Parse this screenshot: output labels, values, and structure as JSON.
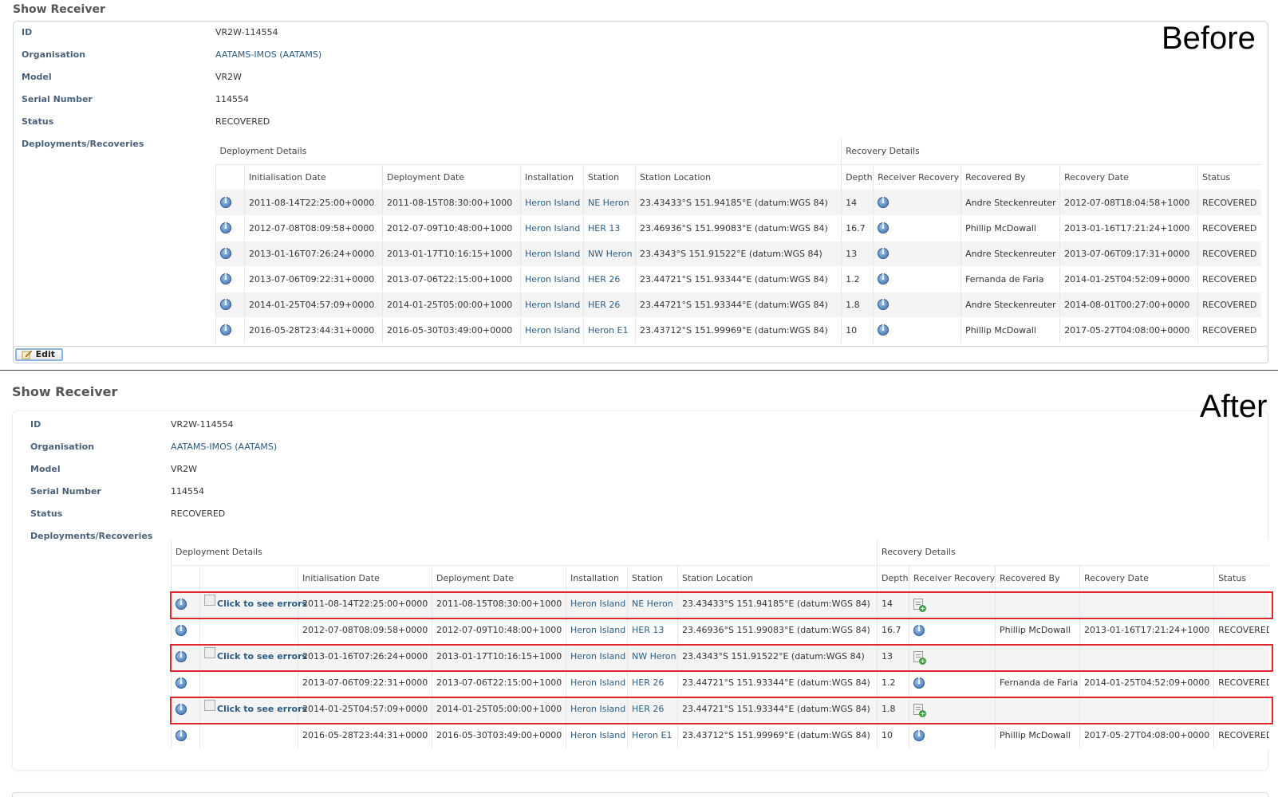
{
  "before": {
    "title": "Show Receiver",
    "label": "Before",
    "props": [
      {
        "label": "ID",
        "value": "VR2W-114554"
      },
      {
        "label": "Organisation",
        "value": "AATAMS-IMOS (AATAMS)"
      },
      {
        "label": "Model",
        "value": "VR2W"
      },
      {
        "label": "Serial Number",
        "value": "114554"
      },
      {
        "label": "Status",
        "value": "RECOVERED"
      },
      {
        "label": "Deployments/Recoveries",
        "value": ""
      }
    ],
    "group_headers": [
      "Deployment Details",
      "Recovery Details"
    ],
    "columns": [
      "",
      "Initialisation Date",
      "Deployment Date",
      "Installation",
      "Station",
      "Station Location",
      "Depth",
      "Receiver Recovery",
      "Recovered By",
      "Recovery Date",
      "Status"
    ],
    "rows": [
      {
        "init": "2011-08-14T22:25:00+0000",
        "deploy": "2011-08-15T08:30:00+1000",
        "installation": "Heron Island",
        "station": "NE Heron",
        "location": "23.43433°S 151.94185°E (datum:WGS 84)",
        "depth": "14",
        "recovered_by": "Andre Steckenreuter",
        "recovery_date": "2012-07-08T18:04:58+1000",
        "status": "RECOVERED"
      },
      {
        "init": "2012-07-08T08:09:58+0000",
        "deploy": "2012-07-09T10:48:00+1000",
        "installation": "Heron Island",
        "station": "HER 13",
        "location": "23.46936°S 151.99083°E (datum:WGS 84)",
        "depth": "16.7",
        "recovered_by": "Phillip McDowall",
        "recovery_date": "2013-01-16T17:21:24+1000",
        "status": "RECOVERED"
      },
      {
        "init": "2013-01-16T07:26:24+0000",
        "deploy": "2013-01-17T10:16:15+1000",
        "installation": "Heron Island",
        "station": "NW Heron",
        "location": "23.4343°S 151.91522°E (datum:WGS 84)",
        "depth": "13",
        "recovered_by": "Andre Steckenreuter",
        "recovery_date": "2013-07-06T09:17:31+0000",
        "status": "RECOVERED"
      },
      {
        "init": "2013-07-06T09:22:31+0000",
        "deploy": "2013-07-06T22:15:00+1000",
        "installation": "Heron Island",
        "station": "HER 26",
        "location": "23.44721°S 151.93344°E (datum:WGS 84)",
        "depth": "1.2",
        "recovered_by": "Fernanda de Faria",
        "recovery_date": "2014-01-25T04:52:09+0000",
        "status": "RECOVERED"
      },
      {
        "init": "2014-01-25T04:57:09+0000",
        "deploy": "2014-01-25T05:00:00+1000",
        "installation": "Heron Island",
        "station": "HER 26",
        "location": "23.44721°S 151.93344°E (datum:WGS 84)",
        "depth": "1.8",
        "recovered_by": "Andre Steckenreuter",
        "recovery_date": "2014-08-01T00:27:00+0000",
        "status": "RECOVERED"
      },
      {
        "init": "2016-05-28T23:44:31+0000",
        "deploy": "2016-05-30T03:49:00+0000",
        "installation": "Heron Island",
        "station": "Heron E1",
        "location": "23.43712°S 151.99969°E (datum:WGS 84)",
        "depth": "10",
        "recovered_by": "Phillip McDowall",
        "recovery_date": "2017-05-27T04:08:00+0000",
        "status": "RECOVERED"
      }
    ],
    "edit_label": "Edit"
  },
  "after": {
    "title": "Show Receiver",
    "label": "After",
    "props": [
      {
        "label": "ID",
        "value": "VR2W-114554"
      },
      {
        "label": "Organisation",
        "value": "AATAMS-IMOS (AATAMS)"
      },
      {
        "label": "Model",
        "value": "VR2W"
      },
      {
        "label": "Serial Number",
        "value": "114554"
      },
      {
        "label": "Status",
        "value": "RECOVERED"
      },
      {
        "label": "Deployments/Recoveries",
        "value": ""
      }
    ],
    "group_headers": [
      "Deployment Details",
      "Recovery Details"
    ],
    "columns": [
      "",
      "",
      "Initialisation Date",
      "Deployment Date",
      "Installation",
      "Station",
      "Station Location",
      "Depth",
      "Receiver Recovery",
      "Recovered By",
      "Recovery Date",
      "Status"
    ],
    "error_text": "Click to see errors",
    "rows": [
      {
        "error": true,
        "init": "2011-08-14T22:25:00+0000",
        "deploy": "2011-08-15T08:30:00+1000",
        "installation": "Heron Island",
        "station": "NE Heron",
        "location": "23.43433°S 151.94185°E (datum:WGS 84)",
        "depth": "14",
        "recovered_by": "",
        "recovery_date": "",
        "status": ""
      },
      {
        "error": false,
        "init": "2012-07-08T08:09:58+0000",
        "deploy": "2012-07-09T10:48:00+1000",
        "installation": "Heron Island",
        "station": "HER 13",
        "location": "23.46936°S 151.99083°E (datum:WGS 84)",
        "depth": "16.7",
        "recovered_by": "Phillip McDowall",
        "recovery_date": "2013-01-16T17:21:24+1000",
        "status": "RECOVERED"
      },
      {
        "error": true,
        "init": "2013-01-16T07:26:24+0000",
        "deploy": "2013-01-17T10:16:15+1000",
        "installation": "Heron Island",
        "station": "NW Heron",
        "location": "23.4343°S 151.91522°E (datum:WGS 84)",
        "depth": "13",
        "recovered_by": "",
        "recovery_date": "",
        "status": ""
      },
      {
        "error": false,
        "init": "2013-07-06T09:22:31+0000",
        "deploy": "2013-07-06T22:15:00+1000",
        "installation": "Heron Island",
        "station": "HER 26",
        "location": "23.44721°S 151.93344°E (datum:WGS 84)",
        "depth": "1.2",
        "recovered_by": "Fernanda de Faria",
        "recovery_date": "2014-01-25T04:52:09+0000",
        "status": "RECOVERED"
      },
      {
        "error": true,
        "init": "2014-01-25T04:57:09+0000",
        "deploy": "2014-01-25T05:00:00+1000",
        "installation": "Heron Island",
        "station": "HER 26",
        "location": "23.44721°S 151.93344°E (datum:WGS 84)",
        "depth": "1.8",
        "recovered_by": "",
        "recovery_date": "",
        "status": ""
      },
      {
        "error": false,
        "init": "2016-05-28T23:44:31+0000",
        "deploy": "2016-05-30T03:49:00+0000",
        "installation": "Heron Island",
        "station": "Heron E1",
        "location": "23.43712°S 151.99969°E (datum:WGS 84)",
        "depth": "10",
        "recovered_by": "Phillip McDowall",
        "recovery_date": "2017-05-27T04:08:00+0000",
        "status": "RECOVERED"
      }
    ]
  },
  "colors": {
    "link": "#2a5d84",
    "label": "#4a6279",
    "error_outline": "#e0262b"
  },
  "icons": {
    "info": "info-icon",
    "add_recovery": "add-recovery-icon",
    "edit": "edit-icon"
  }
}
